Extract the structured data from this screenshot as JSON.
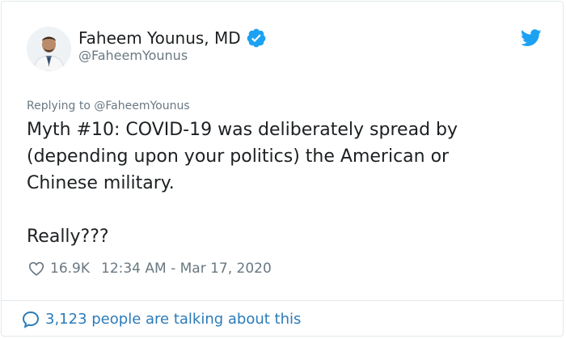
{
  "author": {
    "name": "Faheem Younus, MD",
    "handle": "@FaheemYounus",
    "verified_icon": "verified-badge-icon",
    "avatar": "avatar-photo"
  },
  "brand": {
    "logo_icon": "twitter-bird-icon",
    "accent_color": "#1da1f2"
  },
  "reply_context": "Replying to @FaheemYounus",
  "tweet": {
    "lines": [
      "Myth #10: COVID-19 was deliberately spread by",
      "(depending upon your politics) the American or",
      "Chinese military."
    ],
    "closing": "Really???"
  },
  "meta": {
    "like_icon": "heart-icon",
    "likes": "16.9K",
    "timestamp": "12:34 AM - Mar 17, 2020"
  },
  "conversation": {
    "icon": "speech-bubble-icon",
    "label": "3,123 people are talking about this",
    "link_color": "#2b7bb9"
  }
}
